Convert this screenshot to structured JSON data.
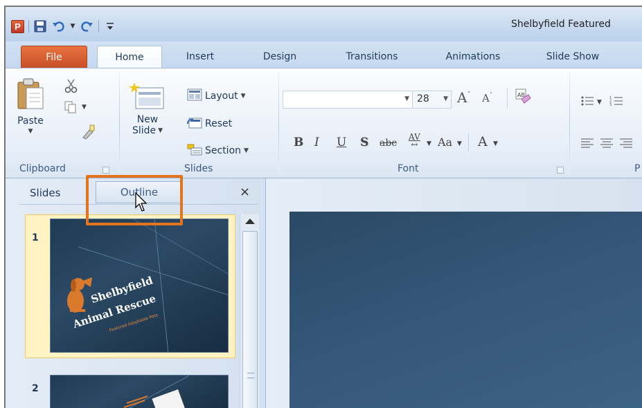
{
  "window": {
    "title": "Shelbyfield Featured",
    "app_icon_letter": "P"
  },
  "tabs": {
    "file": "File",
    "items": [
      "Home",
      "Insert",
      "Design",
      "Transitions",
      "Animations",
      "Slide Show"
    ],
    "active": "Home"
  },
  "ribbon": {
    "clipboard": {
      "paste_label": "Paste",
      "group_label": "Clipboard"
    },
    "slides": {
      "new_slide_label_line1": "New",
      "new_slide_label_line2": "Slide",
      "layout_label": "Layout",
      "reset_label": "Reset",
      "section_label": "Section",
      "group_label": "Slides"
    },
    "font": {
      "font_name": "",
      "font_size": "28",
      "bold": "B",
      "italic": "I",
      "underline": "U",
      "shadow": "S",
      "strike": "abc",
      "spacing": "AV",
      "change_case": "Aa",
      "font_color": "A",
      "group_label": "Font"
    },
    "paragraph": {
      "group_label": "P"
    }
  },
  "slides_pane": {
    "tab_slides": "Slides",
    "tab_outline": "Outline",
    "close": "×",
    "thumbnails": [
      {
        "number": "1",
        "title_line1": "Shelbyfield",
        "title_line2": "Animal Rescue",
        "subtitle": "Featured Adoptable Pets",
        "selected": true
      },
      {
        "number": "2",
        "selected": false
      }
    ]
  },
  "colors": {
    "file_tab": "#d65a2b",
    "highlight_box": "#e2741d",
    "slide_bg": "#25435f",
    "selected_thumb": "#fff3c3"
  }
}
